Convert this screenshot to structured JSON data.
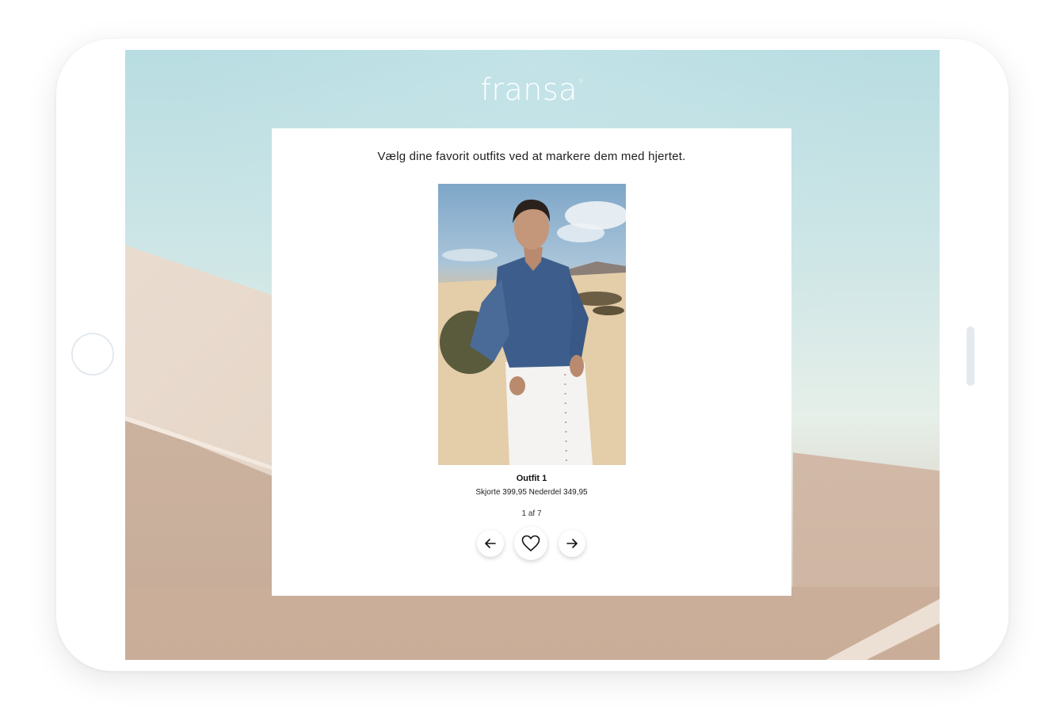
{
  "brand": {
    "logo_text": "fransa",
    "logo_mark": "®"
  },
  "card": {
    "instruction": "Vælg dine favorit outfits ved at markere dem med hjertet.",
    "outfit": {
      "title": "Outfit 1",
      "price_line": "Skjorte 399,95 Nederdel 349,95"
    },
    "pager": "1 af 7"
  },
  "icons": {
    "prev": "arrow-left-icon",
    "favorite": "heart-icon",
    "next": "arrow-right-icon"
  },
  "colors": {
    "card_bg": "#ffffff",
    "text": "#1e1e1e",
    "logo": "#ffffff"
  }
}
